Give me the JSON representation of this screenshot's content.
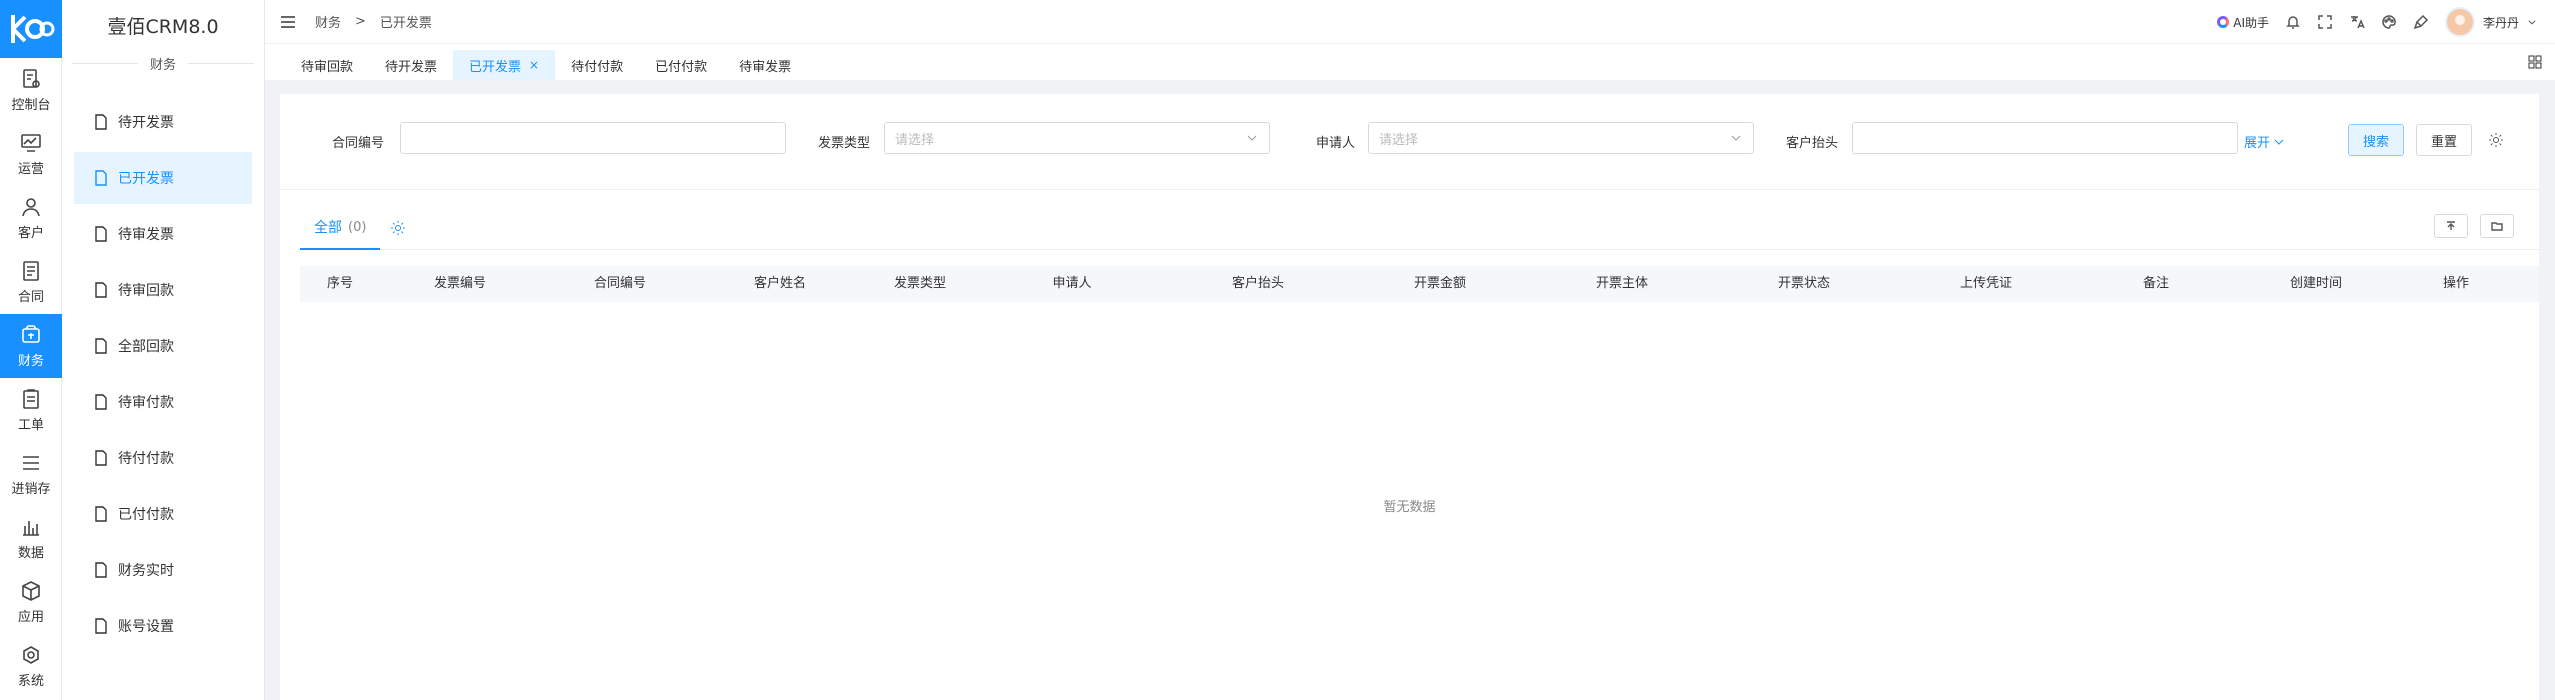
{
  "app": {
    "name": "壹佰CRM8.0",
    "section": "财务"
  },
  "rail": [
    {
      "label": "控制台",
      "icon": "dashboard-icon"
    },
    {
      "label": "运营",
      "icon": "monitor-icon"
    },
    {
      "label": "客户",
      "icon": "user-icon"
    },
    {
      "label": "合同",
      "icon": "contract-icon"
    },
    {
      "label": "财务",
      "icon": "finance-icon"
    },
    {
      "label": "工单",
      "icon": "ticket-icon"
    },
    {
      "label": "进销存",
      "icon": "list-icon"
    },
    {
      "label": "数据",
      "icon": "bar-chart-icon"
    },
    {
      "label": "应用",
      "icon": "cube-icon"
    },
    {
      "label": "系统",
      "icon": "system-icon"
    }
  ],
  "sidebar": {
    "items": [
      {
        "label": "待开发票"
      },
      {
        "label": "已开发票"
      },
      {
        "label": "待审发票"
      },
      {
        "label": "待审回款"
      },
      {
        "label": "全部回款"
      },
      {
        "label": "待审付款"
      },
      {
        "label": "待付付款"
      },
      {
        "label": "已付付款"
      },
      {
        "label": "财务实时"
      },
      {
        "label": "账号设置"
      }
    ]
  },
  "header": {
    "breadcrumb": [
      "财务",
      ">",
      "已开发票"
    ],
    "ai_label": "AI助手",
    "user_name": "李丹丹"
  },
  "tabs": [
    {
      "label": "待审回款"
    },
    {
      "label": "待开发票"
    },
    {
      "label": "已开发票",
      "close": "×"
    },
    {
      "label": "待付付款"
    },
    {
      "label": "已付付款"
    },
    {
      "label": "待审发票"
    }
  ],
  "filters": {
    "contract_no_label": "合同编号",
    "invoice_type_label": "发票类型",
    "invoice_type_placeholder": "请选择",
    "applicant_label": "申请人",
    "applicant_placeholder": "请选择",
    "customer_title_label": "客户抬头",
    "expand_label": "展开",
    "search_label": "搜索",
    "reset_label": "重置"
  },
  "subtab": {
    "label": "全部",
    "count": "(0)"
  },
  "table": {
    "columns": [
      "序号",
      "发票编号",
      "合同编号",
      "客户姓名",
      "发票类型",
      "申请人",
      "客户抬头",
      "开票金额",
      "开票主体",
      "开票状态",
      "上传凭证",
      "备注",
      "创建时间",
      "操作"
    ],
    "empty_text": "暂无数据"
  },
  "colors": {
    "accent": "#1890ff",
    "active_bg": "#e6f4ff"
  }
}
